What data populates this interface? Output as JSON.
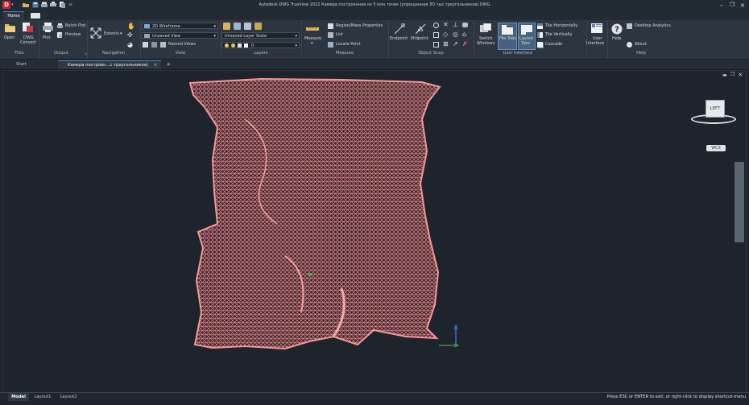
{
  "window": {
    "title": "Autodesk DWG TrueView 2022   Камера построенная из 5 млн точек (упрощенная 3D тыс треугольников).DWG",
    "app_button": "D"
  },
  "ribbon_tabs": [
    "Home"
  ],
  "panels": {
    "files": {
      "title": "Files",
      "open": "Open",
      "dwg_convert_l1": "DWG",
      "dwg_convert_l2": "Convert"
    },
    "output": {
      "title": "Output",
      "plot": "Plot",
      "batch_plot": "Batch Plot",
      "preview": "Preview"
    },
    "navigation": {
      "title": "Navigation",
      "extents": "Extents"
    },
    "view": {
      "title": "View",
      "visual_style": "2D Wireframe",
      "saved_view": "Unsaved View",
      "named_views": "Named Views"
    },
    "layers": {
      "title": "Layers",
      "layer_state": "Unsaved Layer State",
      "layer_current": "0"
    },
    "measure": {
      "title": "Measure",
      "measure": "Measure",
      "region": "Region/Mass Properties",
      "list": "List",
      "locate_point": "Locate Point"
    },
    "osnap": {
      "title": "Object Snap",
      "endpoint": "Endpoint",
      "midpoint": "Midpoint"
    },
    "ui": {
      "title": "User Interface",
      "switch_l1": "Switch",
      "switch_l2": "Windows",
      "file_tabs": "File Tabs",
      "layout_l1": "Layout",
      "layout_l2": "Tabs",
      "tile_h": "Tile Horizontally",
      "tile_v": "Tile Vertically",
      "cascade": "Cascade",
      "user_interface_l1": "User",
      "user_interface_l2": "Interface"
    },
    "help": {
      "title": "Help",
      "help": "Help",
      "desktop_analytics": "Desktop Analytics",
      "about": "About"
    }
  },
  "doc_tabs": {
    "start": "Start",
    "active": "Камера построен...с треугольников)",
    "close": "×",
    "add": "+"
  },
  "viewcube": {
    "face": "LEFT",
    "wcs": "WCS"
  },
  "layout_tabs": [
    "Model",
    "Layout1",
    "Layout2"
  ],
  "status_message": "Press ESC or ENTER to exit, or right-click to display shortcut-menu",
  "colors": {
    "mesh": "#f28a8e",
    "background": "#1e242c",
    "accent": "#3f7fbf"
  }
}
